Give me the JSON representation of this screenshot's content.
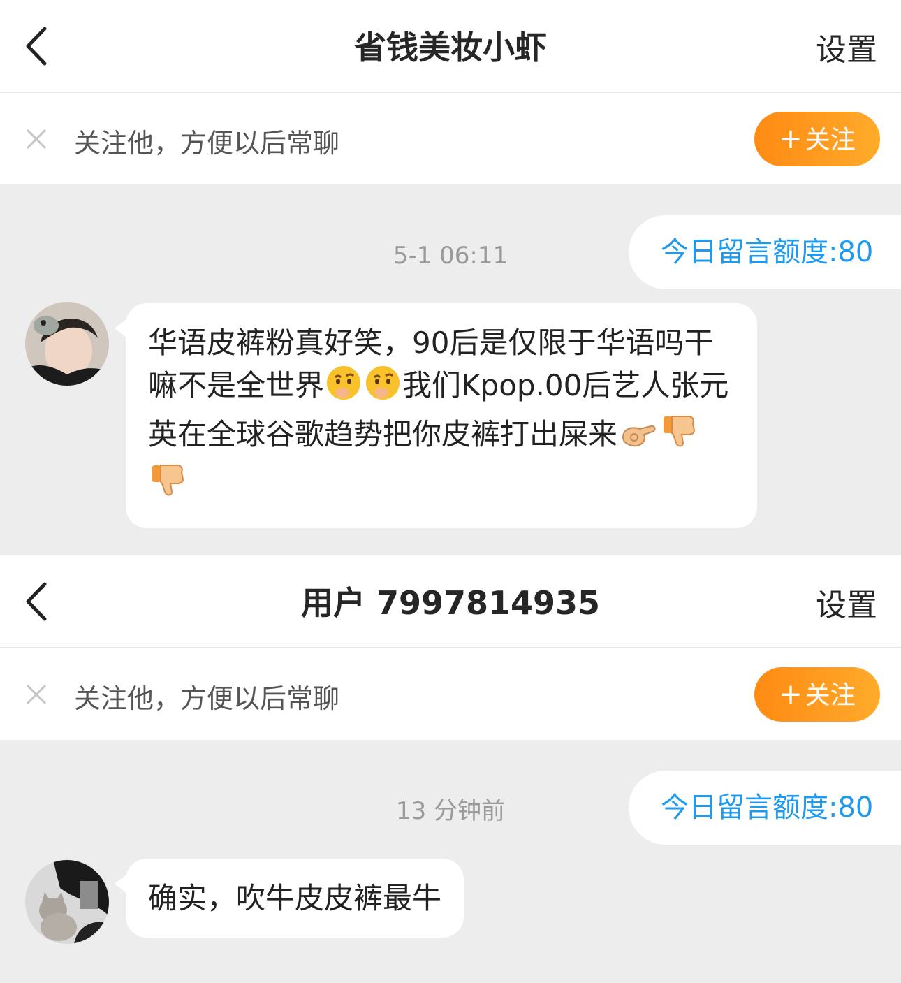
{
  "conversations": [
    {
      "header": {
        "title": "省钱美妆小虾",
        "settings_label": "设置"
      },
      "follow_bar": {
        "hint": "关注他，方便以后常聊",
        "button_label": "关注"
      },
      "timestamp": "5-1 06:11",
      "quota": "今日留言额度:80",
      "message": {
        "text_1": "华语皮裤粉真好笑，90后是仅限于华语吗干嘛不是全世界",
        "text_2": "我们Kpop.00后艺人张元英在全球谷歌趋势把你皮裤打出屎来",
        "emojis_1": [
          "thinking-face-icon",
          "thinking-face-icon"
        ],
        "emojis_2": [
          "beckon-hand-icon",
          "thumbs-down-icon",
          "thumbs-down-icon"
        ]
      }
    },
    {
      "header": {
        "title": "用户 7997814935",
        "settings_label": "设置"
      },
      "follow_bar": {
        "hint": "关注他，方便以后常聊",
        "button_label": "关注"
      },
      "timestamp": "13 分钟前",
      "quota": "今日留言额度:80",
      "message": {
        "text_1": "确实，吹牛皮皮裤最牛"
      }
    }
  ],
  "colors": {
    "accent_orange": "#ff8a14",
    "quota_blue": "#1e9bf0",
    "chat_bg": "#ededed"
  }
}
